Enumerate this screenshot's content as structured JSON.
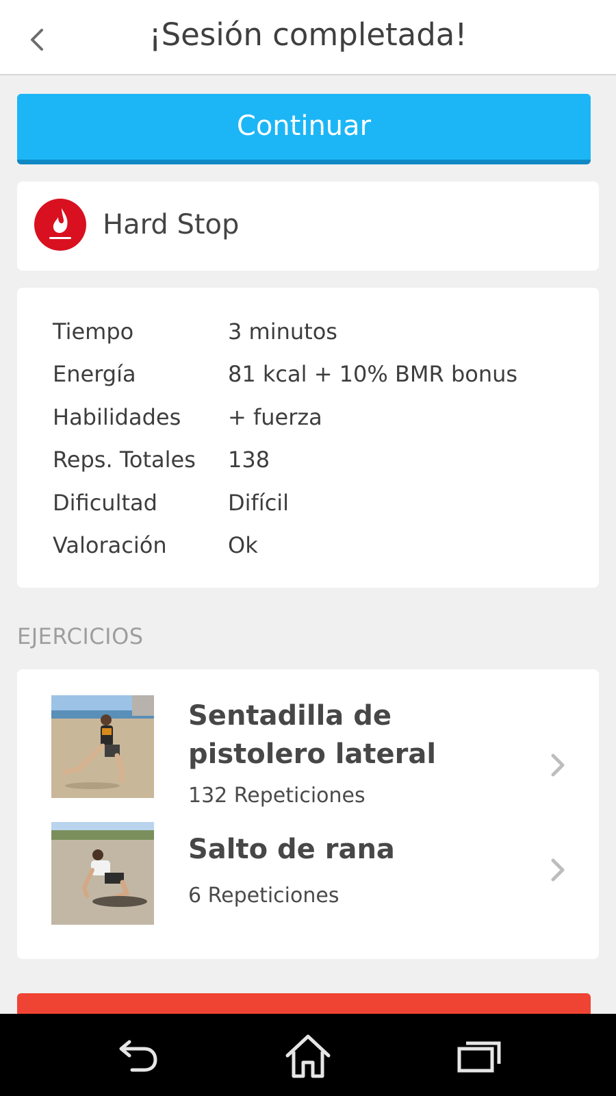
{
  "header": {
    "title": "¡Sesión completada!"
  },
  "continue_label": "Continuar",
  "workout": {
    "name": "Hard Stop",
    "badge_color": "#d9101f"
  },
  "stats": [
    {
      "label": "Tiempo",
      "value": "3 minutos"
    },
    {
      "label": "Energía",
      "value": "81 kcal + 10% BMR bonus"
    },
    {
      "label": "Habilidades",
      "value": "+ fuerza"
    },
    {
      "label": "Reps. Totales",
      "value": "138"
    },
    {
      "label": "Dificultad",
      "value": "Difícil"
    },
    {
      "label": "Valoración",
      "value": "Ok"
    }
  ],
  "exercises_section_title": "EJERCICIOS",
  "exercises": [
    {
      "name": "Sentadilla de pistolero lateral",
      "reps": "132 Repeticiones"
    },
    {
      "name": "Salto de rana",
      "reps": "6 Repeticiones"
    }
  ],
  "colors": {
    "accent": "#1cb6f6",
    "danger": "#ef4434"
  },
  "icons": {
    "back": "back-arrow-icon",
    "nav_back": "nav-back-icon",
    "nav_home": "nav-home-icon",
    "nav_recents": "nav-recents-icon",
    "chevron": "chevron-right-icon"
  }
}
